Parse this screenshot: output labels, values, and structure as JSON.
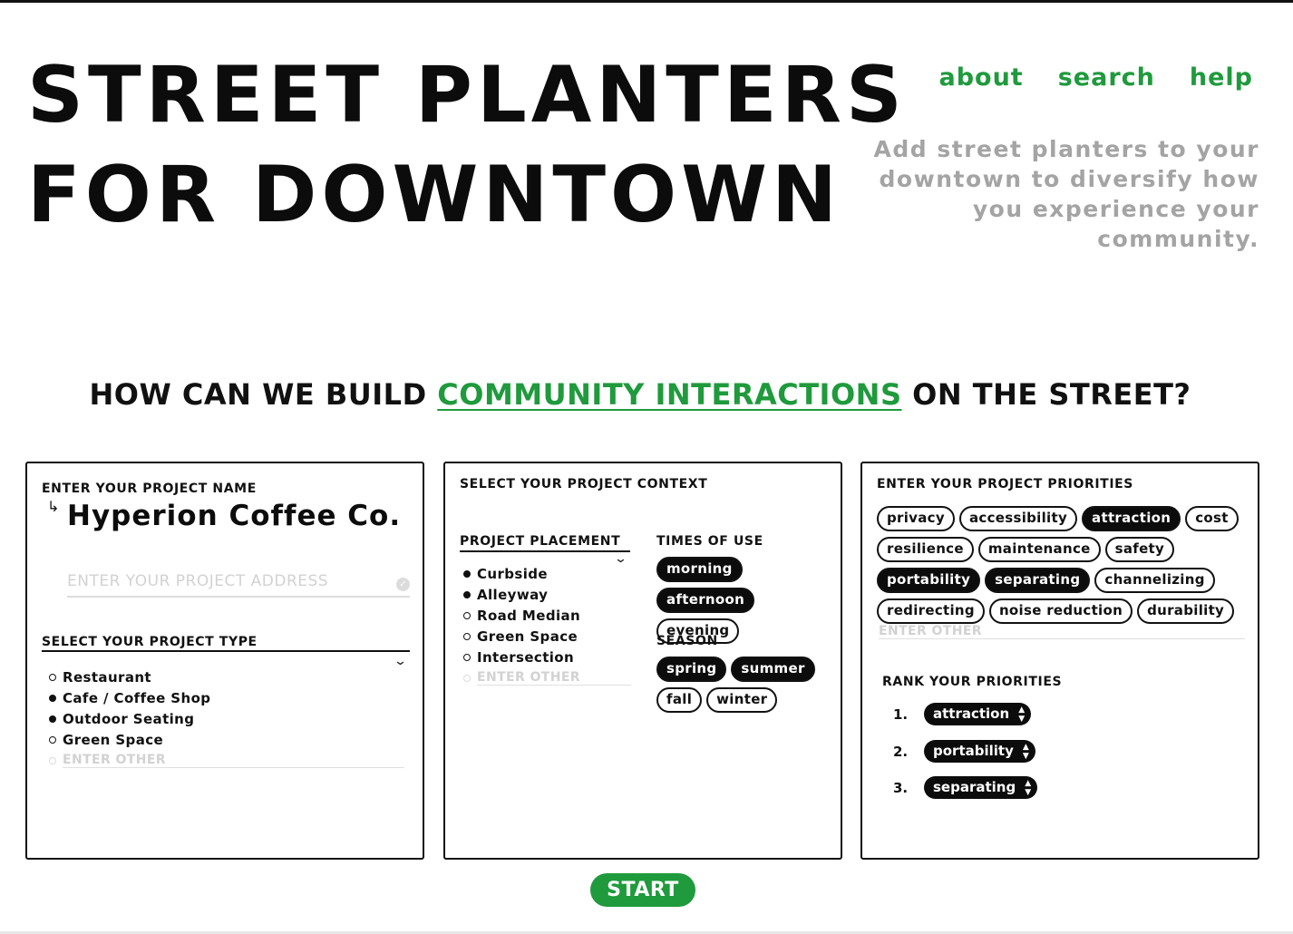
{
  "header": {
    "title_line1": "STREET PLANTERS",
    "title_line2": "FOR DOWNTOWN",
    "nav": [
      "about",
      "search",
      "help"
    ],
    "tagline": "Add street planters to your downtown to diversify how you experience your community."
  },
  "question": {
    "prefix": "HOW CAN WE BUILD ",
    "highlight": "COMMUNITY INTERACTIONS",
    "suffix": " ON THE STREET?"
  },
  "panel1": {
    "name_label": "ENTER YOUR PROJECT NAME",
    "project_name": "Hyperion Coffee Co.",
    "address_placeholder": "ENTER YOUR PROJECT ADDRESS",
    "address_value": "",
    "type_label": "SELECT YOUR PROJECT TYPE",
    "types": [
      {
        "label": "Restaurant",
        "selected": false
      },
      {
        "label": "Cafe / Coffee Shop",
        "selected": true
      },
      {
        "label": "Outdoor Seating",
        "selected": true
      },
      {
        "label": "Green Space",
        "selected": false
      }
    ],
    "other_placeholder": "ENTER OTHER"
  },
  "panel2": {
    "context_label": "SELECT YOUR PROJECT CONTEXT",
    "placement_label": "PROJECT PLACEMENT",
    "placements": [
      {
        "label": "Curbside",
        "selected": true
      },
      {
        "label": "Alleyway",
        "selected": true
      },
      {
        "label": "Road Median",
        "selected": false
      },
      {
        "label": "Green Space",
        "selected": false
      },
      {
        "label": "Intersection",
        "selected": false
      }
    ],
    "other_placeholder": "ENTER OTHER",
    "times_label": "TIMES OF USE",
    "times": [
      {
        "label": "morning",
        "selected": true
      },
      {
        "label": "afternoon",
        "selected": true
      },
      {
        "label": "evening",
        "selected": false
      }
    ],
    "season_label": "SEASON",
    "seasons": [
      {
        "label": "spring",
        "selected": true
      },
      {
        "label": "summer",
        "selected": true
      },
      {
        "label": "fall",
        "selected": false
      },
      {
        "label": "winter",
        "selected": false
      }
    ]
  },
  "panel3": {
    "priorities_label": "ENTER YOUR PROJECT PRIORITIES",
    "priorities": [
      {
        "label": "privacy",
        "selected": false
      },
      {
        "label": "accessibility",
        "selected": false
      },
      {
        "label": "attraction",
        "selected": true
      },
      {
        "label": "cost",
        "selected": false
      },
      {
        "label": "resilience",
        "selected": false
      },
      {
        "label": "maintenance",
        "selected": false
      },
      {
        "label": "safety",
        "selected": false
      },
      {
        "label": "portability",
        "selected": true
      },
      {
        "label": "separating",
        "selected": true
      },
      {
        "label": "channelizing",
        "selected": false
      },
      {
        "label": "redirecting",
        "selected": false
      },
      {
        "label": "noise reduction",
        "selected": false
      },
      {
        "label": "durability",
        "selected": false
      }
    ],
    "other_placeholder": "ENTER OTHER",
    "rank_label": "RANK YOUR PRIORITIES",
    "ranks": [
      {
        "num": "1.",
        "label": "attraction"
      },
      {
        "num": "2.",
        "label": "portability"
      },
      {
        "num": "3.",
        "label": "separating"
      }
    ]
  },
  "start_label": "START",
  "colors": {
    "accent": "#1f9a3c",
    "ink": "#0c0c0c",
    "muted": "#a4a4a4"
  }
}
